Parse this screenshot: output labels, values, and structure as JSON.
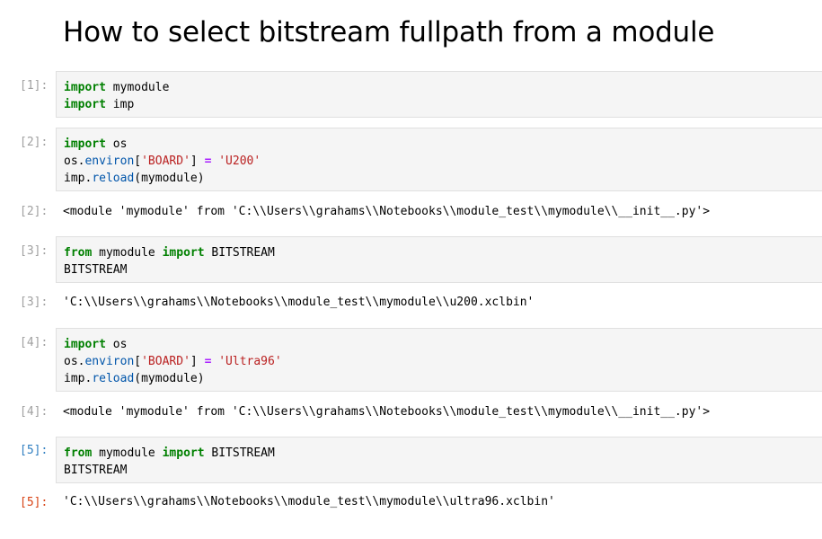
{
  "title": "How to select bitstream fullpath from a module",
  "cells": {
    "c1": {
      "prompt": "[1]:",
      "l1": {
        "kw": "import",
        "rest": " mymodule"
      },
      "l2": {
        "kw": "import",
        "rest": " imp"
      }
    },
    "c2": {
      "prompt": "[2]:",
      "l1": {
        "kw": "import",
        "rest": " os"
      },
      "l2": {
        "a": "os.",
        "attr": "environ",
        "b": "[",
        "str": "'BOARD'",
        "c": "] ",
        "op": "=",
        "d": " ",
        "val": "'U200'"
      },
      "l3": {
        "a": "imp.",
        "attr": "reload",
        "b": "(mymodule)"
      },
      "out_prompt": "[2]:",
      "output": "<module 'mymodule' from 'C:\\\\Users\\\\grahams\\\\Notebooks\\\\module_test\\\\mymodule\\\\__init__.py'>"
    },
    "c3": {
      "prompt": "[3]:",
      "l1": {
        "kw": "from",
        "mid": " mymodule ",
        "kw2": "import",
        "rest": " BITSTREAM"
      },
      "l2": "BITSTREAM",
      "out_prompt": "[3]:",
      "output": "'C:\\\\Users\\\\grahams\\\\Notebooks\\\\module_test\\\\mymodule\\\\u200.xclbin'"
    },
    "c4": {
      "prompt": "[4]:",
      "l1": {
        "kw": "import",
        "rest": " os"
      },
      "l2": {
        "a": "os.",
        "attr": "environ",
        "b": "[",
        "str": "'BOARD'",
        "c": "] ",
        "op": "=",
        "d": " ",
        "val": "'Ultra96'"
      },
      "l3": {
        "a": "imp.",
        "attr": "reload",
        "b": "(mymodule)"
      },
      "out_prompt": "[4]:",
      "output": "<module 'mymodule' from 'C:\\\\Users\\\\grahams\\\\Notebooks\\\\module_test\\\\mymodule\\\\__init__.py'>"
    },
    "c5": {
      "prompt": "[5]:",
      "l1": {
        "kw": "from",
        "mid": " mymodule ",
        "kw2": "import",
        "rest": " BITSTREAM"
      },
      "l2": "BITSTREAM",
      "out_prompt": "[5]:",
      "output": "'C:\\\\Users\\\\grahams\\\\Notebooks\\\\module_test\\\\mymodule\\\\ultra96.xclbin'"
    }
  },
  "colors": {
    "keyword": "#008000",
    "string": "#ba2121",
    "operator": "#aa22ff",
    "attribute": "#0055aa",
    "active_in_prompt": "#307fc1",
    "active_out_prompt": "#d84315",
    "inactive_prompt": "#a0a0a0"
  }
}
